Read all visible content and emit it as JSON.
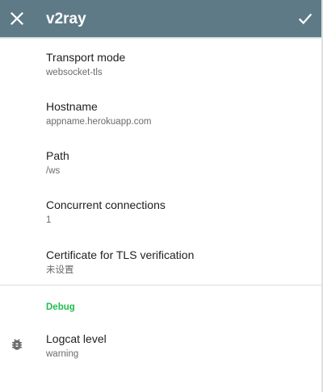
{
  "appbar": {
    "title": "v2ray",
    "close_icon": "close-icon",
    "confirm_icon": "check-icon",
    "color": "#5f7a87"
  },
  "preferences": [
    {
      "title": "Transport mode",
      "summary": "websocket-tls"
    },
    {
      "title": "Hostname",
      "summary": "appname.herokuapp.com"
    },
    {
      "title": "Path",
      "summary": "/ws"
    },
    {
      "title": "Concurrent connections",
      "summary": "1"
    },
    {
      "title": "Certificate for TLS verification",
      "summary": "未设置"
    }
  ],
  "debug": {
    "category": "Debug",
    "category_color": "#1fbf4e",
    "logcat": {
      "title": "Logcat level",
      "summary": "warning",
      "icon": "bug-icon"
    }
  }
}
